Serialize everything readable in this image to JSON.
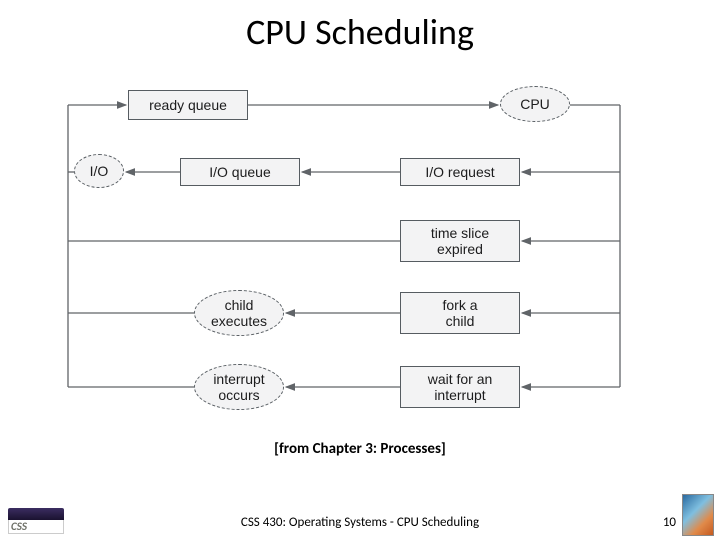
{
  "title": "CPU Scheduling",
  "caption": "[from Chapter 3: Processes]",
  "footer": "CSS 430: Operating Systems - CPU Scheduling",
  "page": "10",
  "logo_text": "CSS",
  "nodes": {
    "ready_queue": "ready queue",
    "cpu": "CPU",
    "io": "I/O",
    "io_queue": "I/O queue",
    "io_request": "I/O request",
    "time_slice": "time slice\nexpired",
    "child_exec": "child\nexecutes",
    "fork_child": "fork a\nchild",
    "interrupt_occurs": "interrupt\noccurs",
    "wait_interrupt": "wait for an\ninterrupt"
  },
  "diagram_structure": {
    "description": "CPU scheduling state diagram. Ready queue feeds CPU. CPU dispatches to one of four wait reasons which each eventually return a process to the ready queue.",
    "edges": [
      {
        "from": "ready_queue",
        "to": "cpu"
      },
      {
        "from": "cpu",
        "to": "io_request"
      },
      {
        "from": "cpu",
        "to": "time_slice"
      },
      {
        "from": "cpu",
        "to": "fork_child"
      },
      {
        "from": "cpu",
        "to": "wait_interrupt"
      },
      {
        "from": "io_request",
        "to": "io_queue"
      },
      {
        "from": "io_queue",
        "to": "io"
      },
      {
        "from": "io",
        "to": "ready_queue",
        "note": "via left bus"
      },
      {
        "from": "time_slice",
        "to": "ready_queue",
        "note": "via left bus"
      },
      {
        "from": "fork_child",
        "to": "child_exec"
      },
      {
        "from": "child_exec",
        "to": "ready_queue",
        "note": "via left bus"
      },
      {
        "from": "wait_interrupt",
        "to": "interrupt_occurs"
      },
      {
        "from": "interrupt_occurs",
        "to": "ready_queue",
        "note": "via left bus"
      }
    ]
  }
}
